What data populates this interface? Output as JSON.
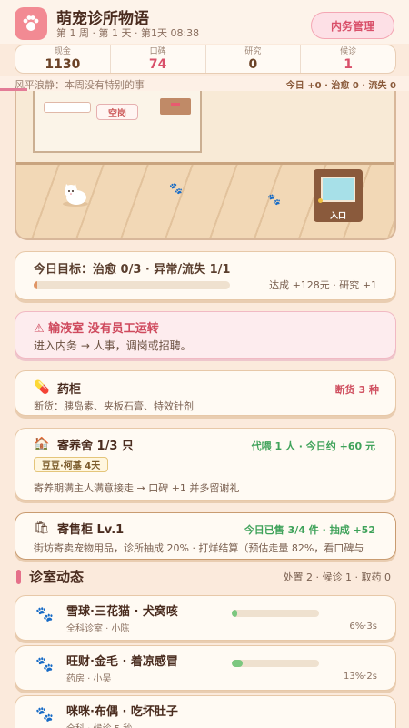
{
  "header": {
    "title": "萌宠诊所物语",
    "subtitle": "第 1 周 · 第 1 天 · 第1天 08:38",
    "manage_button": "内务管理"
  },
  "stats": [
    {
      "label": "现金",
      "value": "1130",
      "color": "#6b4226"
    },
    {
      "label": "口碑",
      "value": "74",
      "color": "#d9506a"
    },
    {
      "label": "研究",
      "value": "0",
      "color": "#6b4226"
    },
    {
      "label": "候诊",
      "value": "1",
      "color": "#d9506a"
    }
  ],
  "status": {
    "left": "风平浪静：本周没有特别的事",
    "right": "今日 +0 · 治愈 0 · 流失 0"
  },
  "scene": {
    "wall_sign": "空岗",
    "door_label": "入口"
  },
  "goal": {
    "title": "今日目标：治愈 0/3 · 异常/流失 1/1",
    "reward": "达成 +128元 · 研究 +1",
    "progress": 0.02
  },
  "alert": {
    "title": "⚠ 输液室 没有员工运转",
    "text": "进入内务 → 人事，调岗或招聘。"
  },
  "cabinet": {
    "icon": "pill-icon",
    "title": "药柜",
    "badge": "断货 3 种",
    "text": "断货：胰岛素、夹板石膏、特效针剂"
  },
  "boarding": {
    "icon": "house-icon",
    "title": "寄养舍 1/3 只",
    "stat": "代喂 1 人 · 今日约 +60 元",
    "chip": "豆豆·柯基 4天",
    "text": "寄养期满主人满意接走 → 口碑 +1 并多留谢礼"
  },
  "shop": {
    "icon": "shopping-bag-icon",
    "title": "寄售柜 Lv.1",
    "stat": "今日已售 3/4 件 · 抽成 +52",
    "text": "街坊寄卖宠物用品，诊所抽成 20% · 打烊结算（预估走量 82%，看口碑与"
  },
  "section": {
    "title": "诊室动态",
    "meta": "处置 2 · 候诊 1 · 取药 0"
  },
  "patients": [
    {
      "name": "雪球·三花猫 · 犬窝咳",
      "location": "全科诊室 · 小陈",
      "pct": "6%·3s",
      "progress": 0.06
    },
    {
      "name": "旺财·金毛 · 着凉感冒",
      "location": "药房 · 小吴",
      "pct": "13%·2s",
      "progress": 0.13
    },
    {
      "name": "咪咪·布偶 · 吃坏肚子",
      "location": "全科 · 候诊 5 秒",
      "pct": "",
      "progress": 0
    }
  ]
}
